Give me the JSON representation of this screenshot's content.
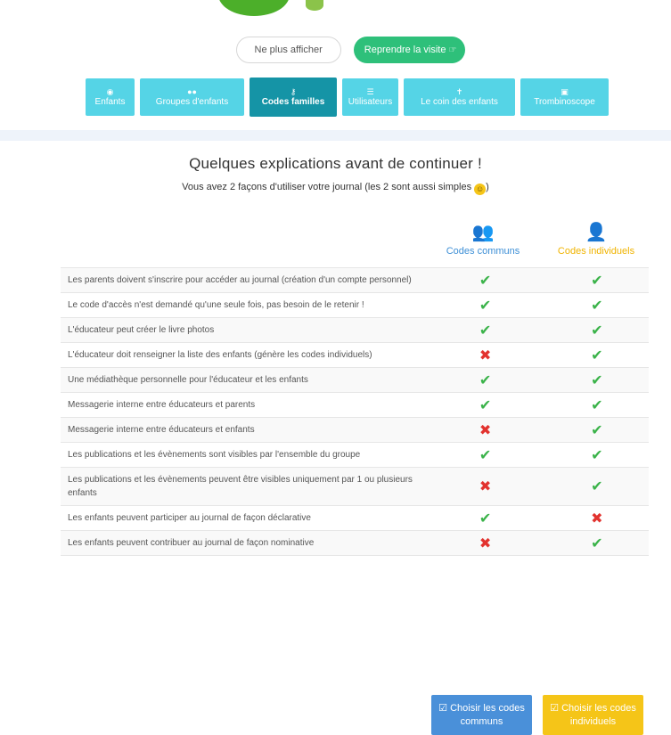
{
  "intro": {
    "hide_label": "Ne plus afficher",
    "resume_label": "Reprendre la visite",
    "resume_icon": "hand-pointer-icon"
  },
  "tabs": [
    {
      "label": "Enfants",
      "icon": "child-icon",
      "active": false
    },
    {
      "label": "Groupes d'enfants",
      "icon": "group-icon",
      "active": false
    },
    {
      "label": "Codes familles",
      "icon": "key-icon",
      "active": true
    },
    {
      "label": "Utilisateurs",
      "icon": "users-list-icon",
      "active": false
    },
    {
      "label": "Le coin des enfants",
      "icon": "child-corner-icon",
      "active": false
    },
    {
      "label": "Trombinoscope",
      "icon": "picture-icon",
      "active": false
    }
  ],
  "heading": {
    "title": "Quelques explications avant de continuer !",
    "subtitle": "Vous avez 2 façons d'utiliser votre journal (les 2 sont aussi simples"
  },
  "columns": {
    "communs": "Codes communs",
    "individuels": "Codes individuels"
  },
  "rows": [
    {
      "label": "Les parents doivent s'inscrire pour accéder au journal (création d'un compte personnel)",
      "communs": true,
      "individuels": true
    },
    {
      "label": "Le code d'accès n'est demandé qu'une seule fois, pas besoin de le retenir !",
      "communs": true,
      "individuels": true
    },
    {
      "label": "L'éducateur peut créer le livre photos",
      "communs": true,
      "individuels": true
    },
    {
      "label": "L'éducateur doit renseigner la liste des enfants (génère les codes individuels)",
      "communs": false,
      "individuels": true
    },
    {
      "label": "Une médiathèque personnelle pour l'éducateur et les enfants",
      "communs": true,
      "individuels": true
    },
    {
      "label": "Messagerie interne entre éducateurs et parents",
      "communs": true,
      "individuels": true
    },
    {
      "label": "Messagerie interne entre éducateurs et enfants",
      "communs": false,
      "individuels": true
    },
    {
      "label": "Les publications et les évènements sont visibles par l'ensemble du groupe",
      "communs": true,
      "individuels": true
    },
    {
      "label": "Les publications et les évènements peuvent être visibles uniquement par 1 ou plusieurs enfants",
      "communs": false,
      "individuels": true
    },
    {
      "label": "Les enfants peuvent participer au journal de façon déclarative",
      "communs": true,
      "individuels": false
    },
    {
      "label": "Les enfants peuvent contribuer au journal de façon nominative",
      "communs": false,
      "individuels": true
    }
  ],
  "actions": {
    "choose_communs": "Choisir les codes communs",
    "choose_individuels": "Choisir les codes individuels"
  },
  "colors": {
    "tab": "#55d4e6",
    "tab_active": "#1594a6",
    "resume": "#2ec07a",
    "communs": "#4a90d9",
    "individuels": "#f5c518",
    "check": "#3bb34a",
    "cross": "#e2332f"
  }
}
